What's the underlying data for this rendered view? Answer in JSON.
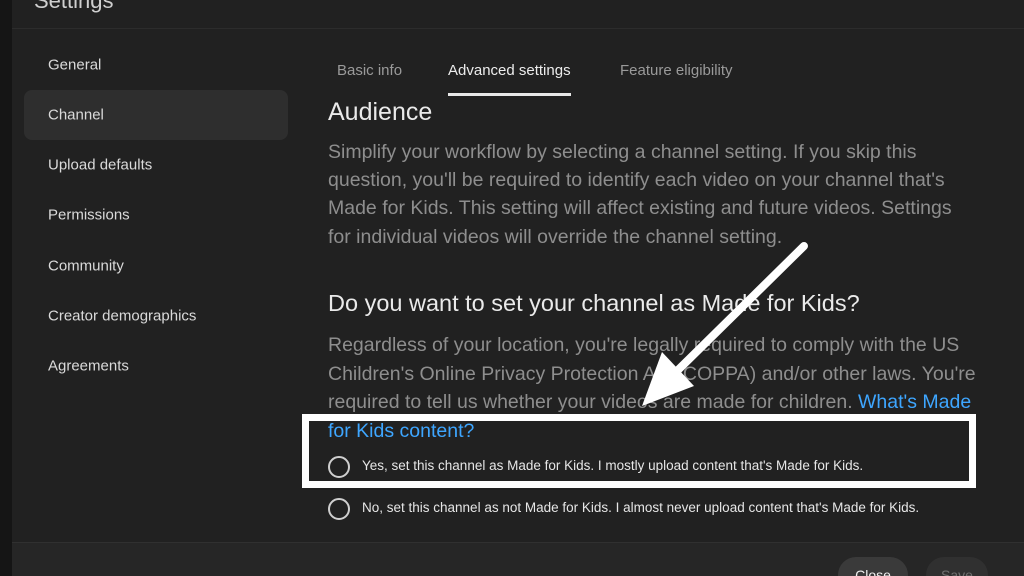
{
  "dialog": {
    "title": "Settings"
  },
  "sidebar": {
    "items": [
      {
        "label": "General",
        "active": false
      },
      {
        "label": "Channel",
        "active": true
      },
      {
        "label": "Upload defaults",
        "active": false
      },
      {
        "label": "Permissions",
        "active": false
      },
      {
        "label": "Community",
        "active": false
      },
      {
        "label": "Creator demographics",
        "active": false
      },
      {
        "label": "Agreements",
        "active": false
      }
    ]
  },
  "tabs": [
    {
      "label": "Basic info",
      "active": false
    },
    {
      "label": "Advanced settings",
      "active": true
    },
    {
      "label": "Feature eligibility",
      "active": false
    }
  ],
  "audience": {
    "heading": "Audience",
    "description": "Simplify your workflow by selecting a channel setting. If you skip this question, you'll be required to identify each video on your channel that's Made for Kids. This setting will affect existing and future videos. Settings for individual videos will override the channel setting.",
    "question": "Do you want to set your channel as Made for Kids?",
    "legal_text": "Regardless of your location, you're legally required to comply with the US Children's Online Privacy Protection Act (COPPA) and/or other laws. You're required to tell us whether your videos are made for children.",
    "learn_more_link": "What's Made for Kids content?",
    "options": [
      {
        "label": "Yes, set this channel as Made for Kids. I mostly upload content that's Made for Kids.",
        "selected": false
      },
      {
        "label": "No, set this channel as not Made for Kids. I almost never upload content that's Made for Kids.",
        "selected": false
      }
    ]
  },
  "footer": {
    "close_label": "Close",
    "save_label": "Save"
  },
  "colors": {
    "background": "#212121",
    "link": "#3ea6ff",
    "highlight": "#ffffff"
  }
}
